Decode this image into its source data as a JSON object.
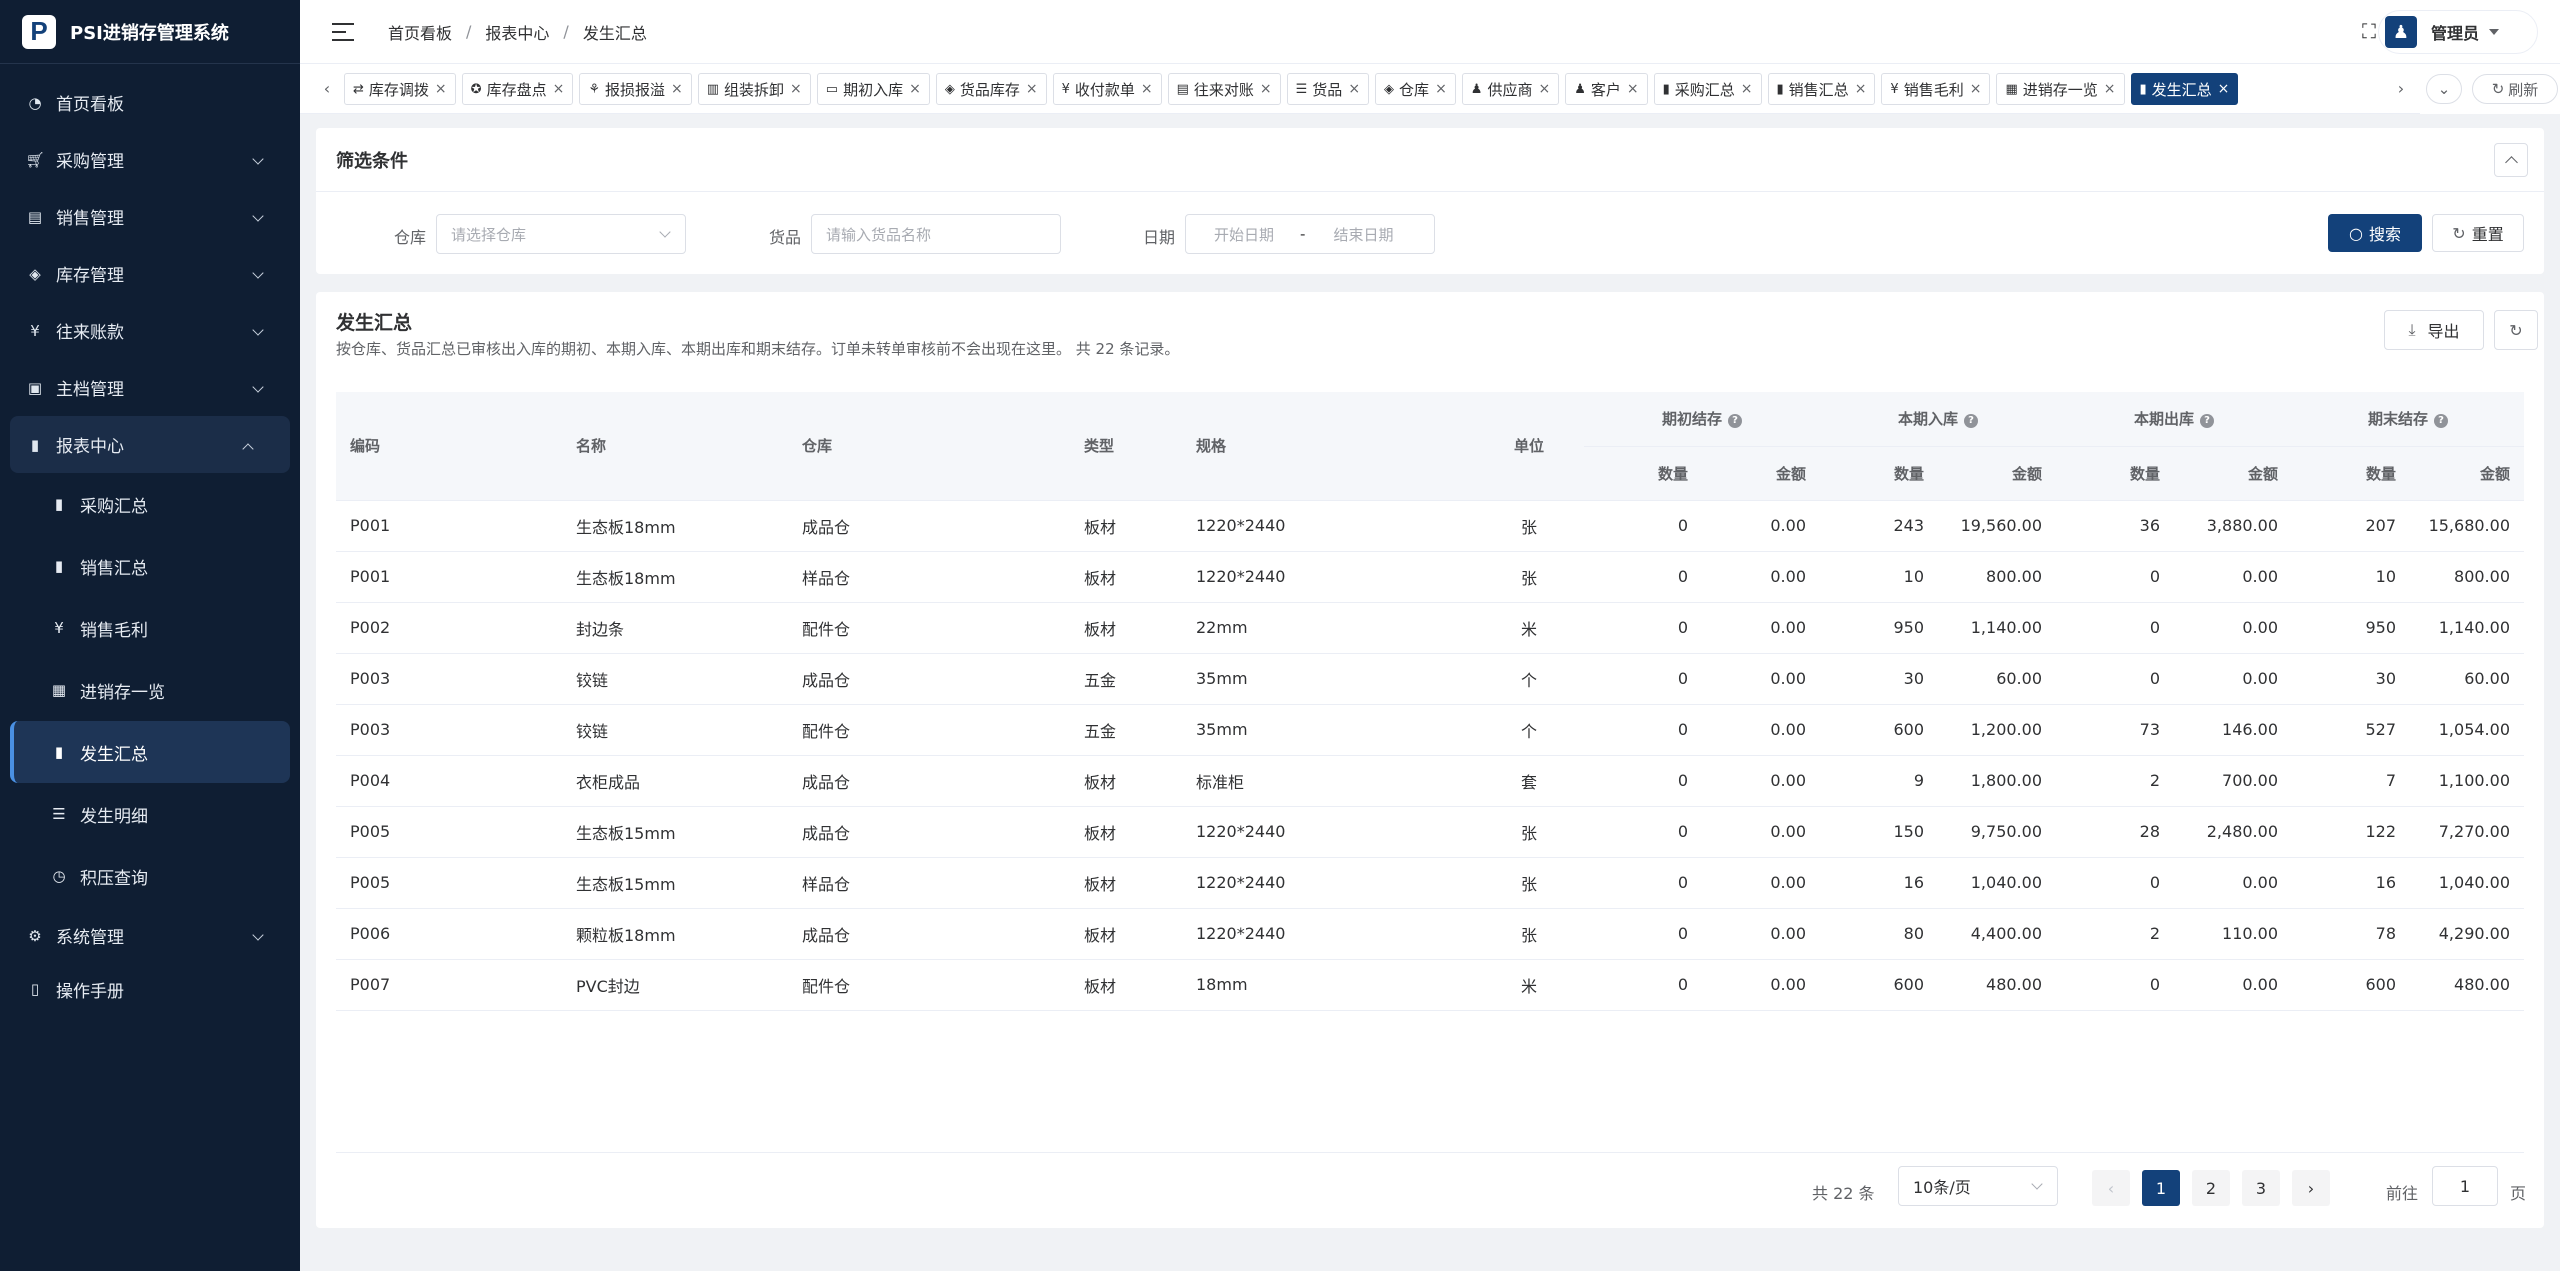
{
  "app": {
    "logo_letter": "P",
    "name": "PSI进销存管理系统"
  },
  "sidebar": {
    "items": [
      {
        "label": "首页看板",
        "icon": "dashboard-icon"
      },
      {
        "label": "采购管理",
        "icon": "cart-icon"
      },
      {
        "label": "销售管理",
        "icon": "sales-icon"
      },
      {
        "label": "库存管理",
        "icon": "layers-icon"
      },
      {
        "label": "往来账款",
        "icon": "yen-icon"
      },
      {
        "label": "主档管理",
        "icon": "master-icon"
      },
      {
        "label": "报表中心",
        "icon": "chart-icon"
      },
      {
        "label": "系统管理",
        "icon": "gear-icon"
      },
      {
        "label": "操作手册",
        "icon": "book-icon"
      }
    ],
    "report_sub": [
      {
        "label": "采购汇总",
        "icon": "bar-chart-icon"
      },
      {
        "label": "销售汇总",
        "icon": "bar-chart-icon"
      },
      {
        "label": "销售毛利",
        "icon": "yen-icon"
      },
      {
        "label": "进销存一览",
        "icon": "grid-icon"
      },
      {
        "label": "发生汇总",
        "icon": "bar-chart-icon"
      },
      {
        "label": "发生明细",
        "icon": "list-icon"
      },
      {
        "label": "积压查询",
        "icon": "clock-icon"
      }
    ]
  },
  "header": {
    "breadcrumb": [
      "首页看板",
      "报表中心",
      "发生汇总"
    ],
    "user": "管理员"
  },
  "tags": {
    "items": [
      "库存调拨",
      "库存盘点",
      "报损报溢",
      "组装拆卸",
      "期初入库",
      "货品库存",
      "收付款单",
      "往来对账",
      "货品",
      "仓库",
      "供应商",
      "客户",
      "采购汇总",
      "销售汇总",
      "销售毛利",
      "进销存一览",
      "发生汇总"
    ],
    "refresh": "刷新"
  },
  "filter": {
    "title": "筛选条件",
    "warehouse_label": "仓库",
    "warehouse_placeholder": "请选择仓库",
    "goods_label": "货品",
    "goods_placeholder": "请输入货品名称",
    "date_label": "日期",
    "date_start": "开始日期",
    "date_sep": "-",
    "date_end": "结束日期",
    "search": "搜索",
    "reset": "重置"
  },
  "table": {
    "title": "发生汇总",
    "desc": "按仓库、货品汇总已审核出入库的期初、本期入库、本期出库和期末结存。订单未转单审核前不会出现在这里。 共 22 条记录。",
    "export": "导出",
    "columns": {
      "code": "编码",
      "name": "名称",
      "warehouse": "仓库",
      "type": "类型",
      "spec": "规格",
      "unit": "单位"
    },
    "groups": [
      "期初结存",
      "本期入库",
      "本期出库",
      "期末结存"
    ],
    "sub_qty": "数量",
    "sub_amt": "金额",
    "rows": [
      [
        "P001",
        "生态板18mm",
        "成品仓",
        "板材",
        "1220*2440",
        "张",
        "0",
        "0.00",
        "243",
        "19,560.00",
        "36",
        "3,880.00",
        "207",
        "15,680.00"
      ],
      [
        "P001",
        "生态板18mm",
        "样品仓",
        "板材",
        "1220*2440",
        "张",
        "0",
        "0.00",
        "10",
        "800.00",
        "0",
        "0.00",
        "10",
        "800.00"
      ],
      [
        "P002",
        "封边条",
        "配件仓",
        "板材",
        "22mm",
        "米",
        "0",
        "0.00",
        "950",
        "1,140.00",
        "0",
        "0.00",
        "950",
        "1,140.00"
      ],
      [
        "P003",
        "铰链",
        "成品仓",
        "五金",
        "35mm",
        "个",
        "0",
        "0.00",
        "30",
        "60.00",
        "0",
        "0.00",
        "30",
        "60.00"
      ],
      [
        "P003",
        "铰链",
        "配件仓",
        "五金",
        "35mm",
        "个",
        "0",
        "0.00",
        "600",
        "1,200.00",
        "73",
        "146.00",
        "527",
        "1,054.00"
      ],
      [
        "P004",
        "衣柜成品",
        "成品仓",
        "板材",
        "标准柜",
        "套",
        "0",
        "0.00",
        "9",
        "1,800.00",
        "2",
        "700.00",
        "7",
        "1,100.00"
      ],
      [
        "P005",
        "生态板15mm",
        "成品仓",
        "板材",
        "1220*2440",
        "张",
        "0",
        "0.00",
        "150",
        "9,750.00",
        "28",
        "2,480.00",
        "122",
        "7,270.00"
      ],
      [
        "P005",
        "生态板15mm",
        "样品仓",
        "板材",
        "1220*2440",
        "张",
        "0",
        "0.00",
        "16",
        "1,040.00",
        "0",
        "0.00",
        "16",
        "1,040.00"
      ],
      [
        "P006",
        "颗粒板18mm",
        "成品仓",
        "板材",
        "1220*2440",
        "张",
        "0",
        "0.00",
        "80",
        "4,400.00",
        "2",
        "110.00",
        "78",
        "4,290.00"
      ],
      [
        "P007",
        "PVC封边",
        "配件仓",
        "板材",
        "18mm",
        "米",
        "0",
        "0.00",
        "600",
        "480.00",
        "0",
        "0.00",
        "600",
        "480.00"
      ]
    ]
  },
  "pager": {
    "total": "共 22 条",
    "size": "10条/页",
    "pages": [
      "1",
      "2",
      "3"
    ],
    "goto": "前往",
    "current": "1",
    "page_unit": "页"
  }
}
